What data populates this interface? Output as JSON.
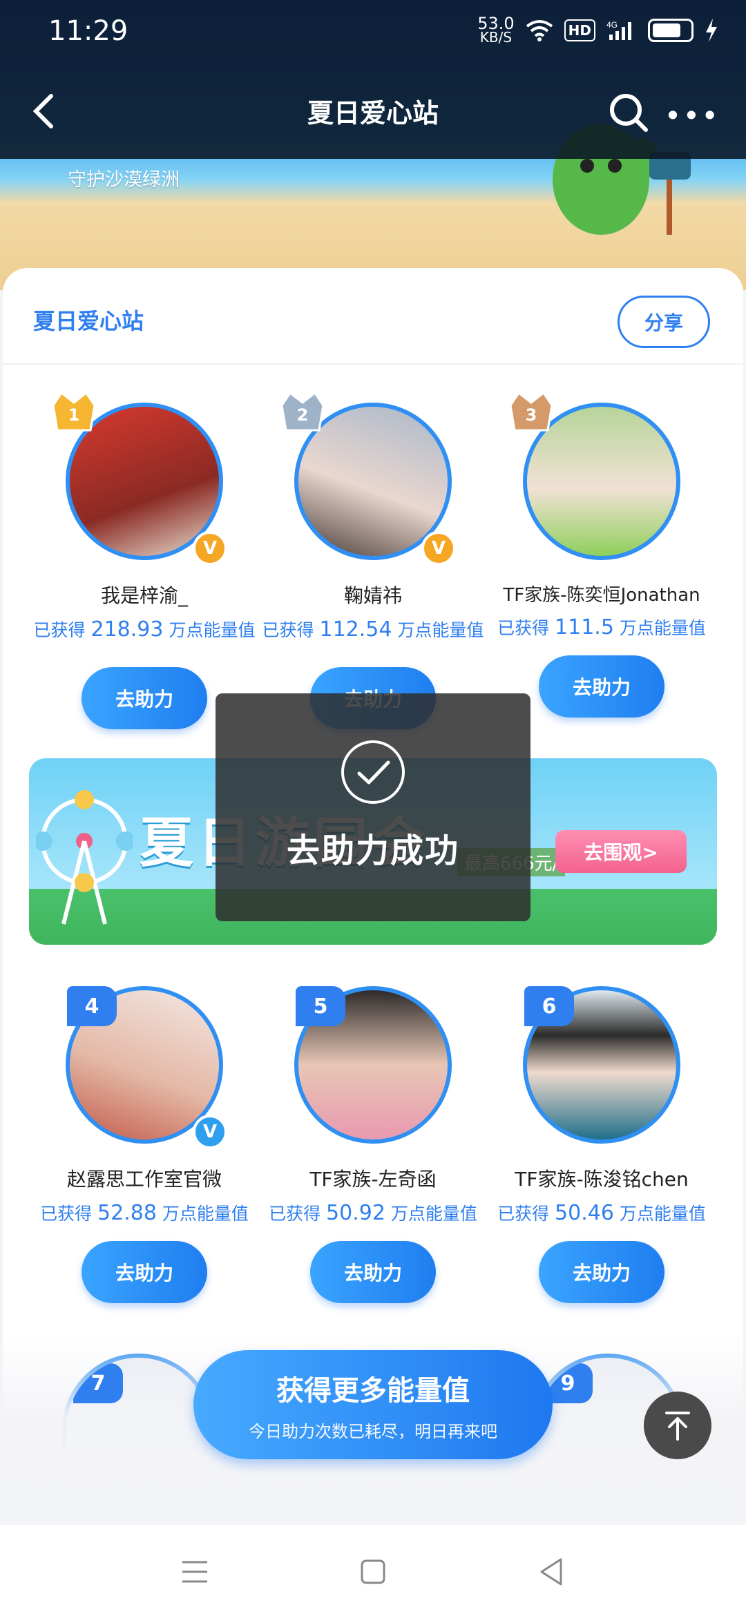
{
  "status_bar": {
    "time": "11:29",
    "speed_value": "53.0",
    "speed_unit": "KB/S",
    "hd": "HD",
    "network": "4G"
  },
  "header": {
    "title": "夏日爱心站",
    "subtitle": "守护沙漠绿洲"
  },
  "card": {
    "title": "夏日爱心站",
    "share_label": "分享"
  },
  "stars": [
    {
      "rank": "1",
      "name": "我是梓渝_",
      "energy_prefix": "已获得",
      "energy_value": "218.93",
      "energy_suffix": "万点能量值",
      "verified": "gold",
      "help_label": "去助力",
      "avatar_color": "#c9402f"
    },
    {
      "rank": "2",
      "name": "鞠婧祎",
      "energy_prefix": "已获得",
      "energy_value": "112.54",
      "energy_suffix": "万点能量值",
      "verified": "gold",
      "help_label": "去助力",
      "avatar_color": "#cdb8b4"
    },
    {
      "rank": "3",
      "name": "TF家族-陈奕恒Jonathan",
      "energy_prefix": "已获得",
      "energy_value": "111.5",
      "energy_suffix": "万点能量值",
      "verified": "",
      "help_label": "去助力",
      "avatar_color": "#9bbf6a"
    },
    {
      "rank": "4",
      "name": "赵露思工作室官微",
      "energy_prefix": "已获得",
      "energy_value": "52.88",
      "energy_suffix": "万点能量值",
      "verified": "blue",
      "help_label": "去助力",
      "avatar_color": "#e7c9c0"
    },
    {
      "rank": "5",
      "name": "TF家族-左奇函",
      "energy_prefix": "已获得",
      "energy_value": "50.92",
      "energy_suffix": "万点能量值",
      "verified": "",
      "help_label": "去助力",
      "avatar_color": "#d5b8aa"
    },
    {
      "rank": "6",
      "name": "TF家族-陈浚铭chen",
      "energy_prefix": "已获得",
      "energy_value": "50.46",
      "energy_suffix": "万点能量值",
      "verified": "",
      "help_label": "去助力",
      "avatar_color": "#8fb8d0"
    }
  ],
  "partial_ranks": [
    "7",
    "9"
  ],
  "banner": {
    "title": "夏日游园会",
    "button_label": "去围观>",
    "note": "最高666元/"
  },
  "toast": {
    "text": "去助力成功"
  },
  "cta": {
    "title": "获得更多能量值",
    "subtitle": "今日助力次数已耗尽，明日再来吧"
  },
  "colors": {
    "accent": "#2f7ff0",
    "gold": "#f5a623",
    "toast_bg": "#2d2d2d"
  }
}
